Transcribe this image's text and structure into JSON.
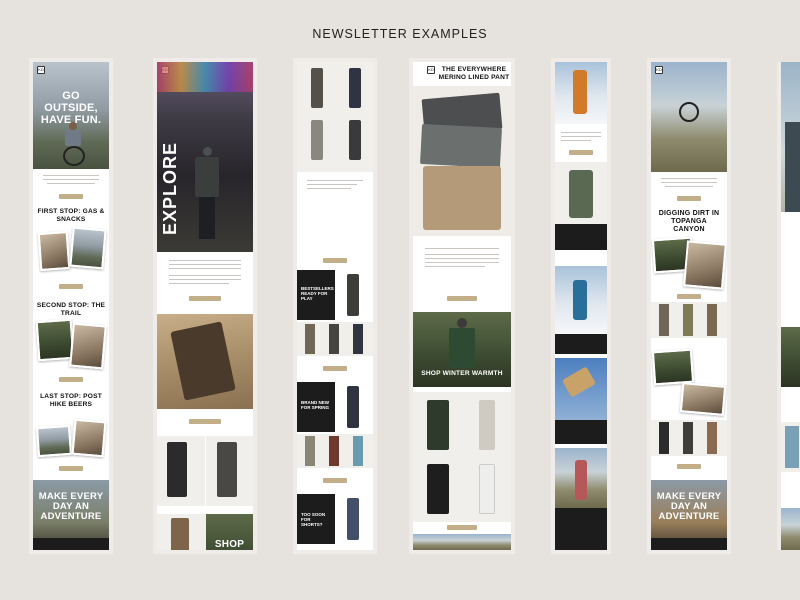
{
  "page": {
    "title": "NEWSLETTER EXAMPLES"
  },
  "newsletters": {
    "n1": {
      "logo": "KD",
      "hero_heading": "GO OUTSIDE, HAVE FUN.",
      "sections": [
        "FIRST STOP: GAS & SNACKS",
        "SECOND STOP: THE TRAIL",
        "LAST STOP: POST HIKE BEERS"
      ],
      "footer_heading": "MAKE EVERY DAY AN ADVENTURE"
    },
    "n2": {
      "logo": "KD",
      "hero_vertical": "EXPLORE",
      "overlay_text": "SHOP ALL"
    },
    "n3": {
      "cards": [
        "BESTSELLERS READY FOR PLAY",
        "BRAND NEW FOR SPRING",
        "TOO SOON FOR SHORTS?"
      ]
    },
    "n4": {
      "logo": "KD",
      "hero_heading": "THE EVERYWHERE MERINO LINED PANT",
      "mid_heading": "SHOP WINTER WARMTH"
    },
    "n6": {
      "logo": "KD",
      "section_heading": "DIGGING DIRT IN TOPANGA CANYON",
      "footer_heading": "MAKE EVERY DAY AN ADVENTURE"
    }
  },
  "colors": {
    "background": "#e6e2dd",
    "button": "#c2ae88",
    "dark_panel": "#1c1c1c"
  }
}
